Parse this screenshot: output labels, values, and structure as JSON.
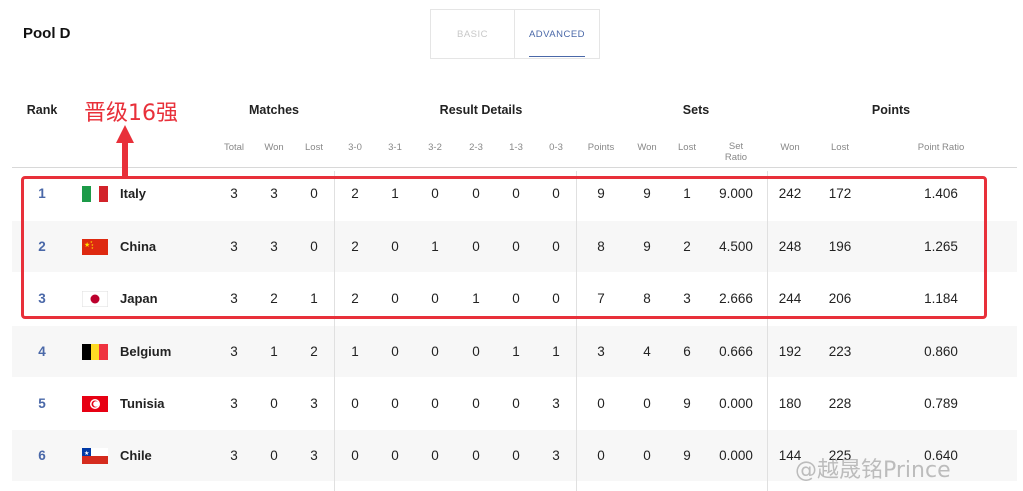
{
  "header": {
    "pool_title": "Pool D",
    "tab_basic": "BASIC",
    "tab_advanced": "ADVANCED"
  },
  "annotation": {
    "text": "晋级16强"
  },
  "watermark": "@越晟铭Prince",
  "columns": {
    "rank": "Rank",
    "groups": {
      "matches": "Matches",
      "result_details": "Result Details",
      "sets": "Sets",
      "points": "Points"
    },
    "subheaders": [
      "Total",
      "Won",
      "Lost",
      "3-0",
      "3-1",
      "3-2",
      "2-3",
      "1-3",
      "0-3",
      "Points",
      "Won",
      "Lost",
      "Set Ratio",
      "Won",
      "Lost",
      "Point Ratio"
    ]
  },
  "rows": [
    {
      "rank": "1",
      "country": "Italy",
      "flag": "italy",
      "vals": [
        "3",
        "3",
        "0",
        "2",
        "1",
        "0",
        "0",
        "0",
        "0",
        "9",
        "9",
        "1",
        "9.000",
        "242",
        "172",
        "1.406"
      ]
    },
    {
      "rank": "2",
      "country": "China",
      "flag": "china",
      "vals": [
        "3",
        "3",
        "0",
        "2",
        "0",
        "1",
        "0",
        "0",
        "0",
        "8",
        "9",
        "2",
        "4.500",
        "248",
        "196",
        "1.265"
      ]
    },
    {
      "rank": "3",
      "country": "Japan",
      "flag": "japan",
      "vals": [
        "3",
        "2",
        "1",
        "2",
        "0",
        "0",
        "1",
        "0",
        "0",
        "7",
        "8",
        "3",
        "2.666",
        "244",
        "206",
        "1.184"
      ]
    },
    {
      "rank": "4",
      "country": "Belgium",
      "flag": "belgium",
      "vals": [
        "3",
        "1",
        "2",
        "1",
        "0",
        "0",
        "0",
        "1",
        "1",
        "3",
        "4",
        "6",
        "0.666",
        "192",
        "223",
        "0.860"
      ]
    },
    {
      "rank": "5",
      "country": "Tunisia",
      "flag": "tunisia",
      "vals": [
        "3",
        "0",
        "3",
        "0",
        "0",
        "0",
        "0",
        "0",
        "3",
        "0",
        "0",
        "9",
        "0.000",
        "180",
        "228",
        "0.789"
      ]
    },
    {
      "rank": "6",
      "country": "Chile",
      "flag": "chile",
      "vals": [
        "3",
        "0",
        "3",
        "0",
        "0",
        "0",
        "0",
        "0",
        "3",
        "0",
        "0",
        "9",
        "0.000",
        "144",
        "225",
        "0.640"
      ]
    }
  ],
  "colors": {
    "rank_accent": "#4a68a8",
    "highlight": "#e8303a"
  }
}
